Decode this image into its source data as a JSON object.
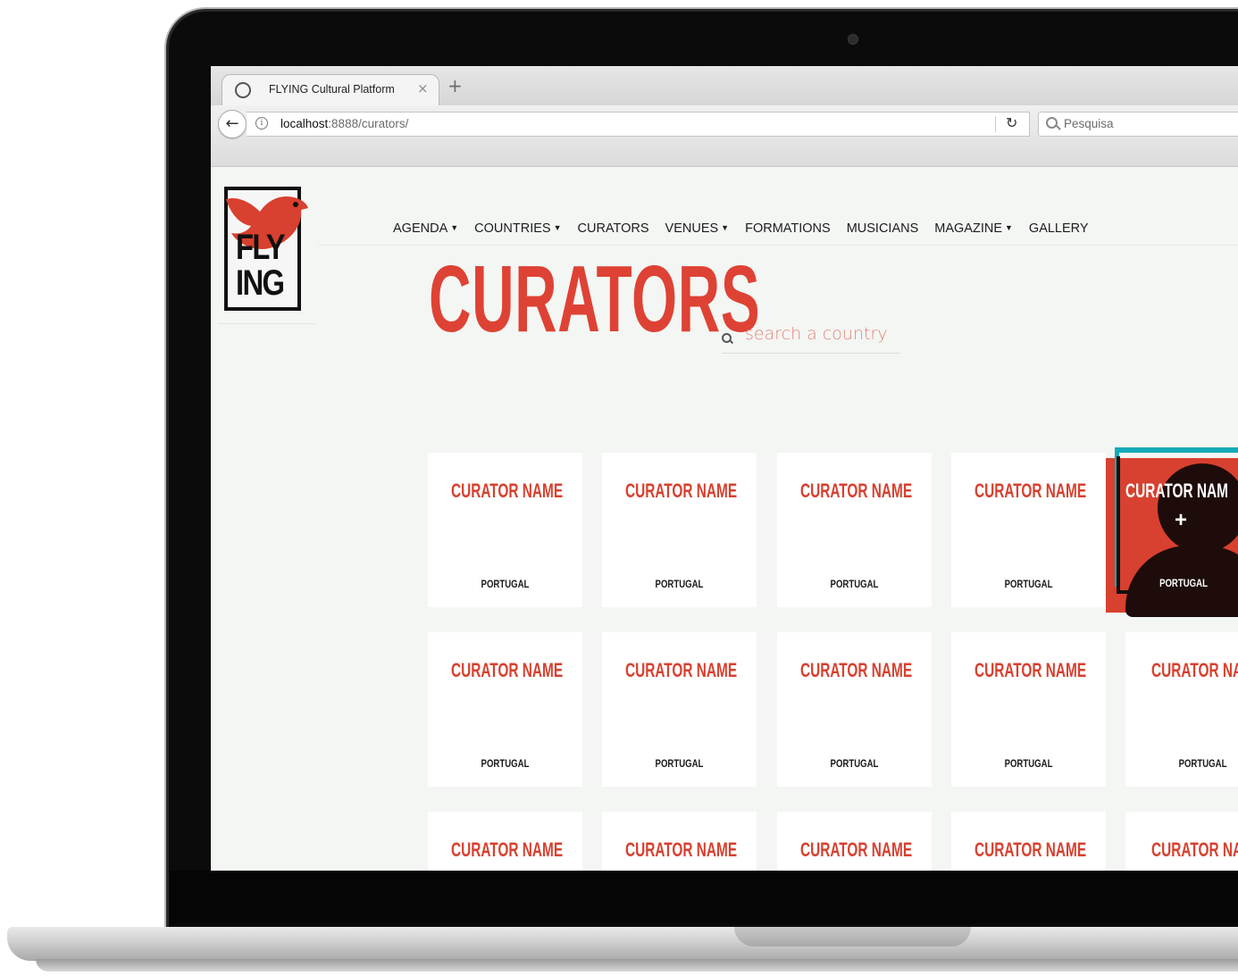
{
  "browser": {
    "tab_title": "FLYING Cultural Platform",
    "tab_close": "×",
    "new_tab": "+",
    "url_host": "localhost",
    "url_path": ":8888/curators/",
    "search_placeholder": "Pesquisa"
  },
  "site": {
    "logo_line1": "FLY",
    "logo_line2": "ING",
    "nav": [
      {
        "label": "AGENDA",
        "dropdown": true
      },
      {
        "label": "COUNTRIES",
        "dropdown": true
      },
      {
        "label": "CURATORS",
        "dropdown": false
      },
      {
        "label": "VENUES",
        "dropdown": true
      },
      {
        "label": "FORMATIONS",
        "dropdown": false
      },
      {
        "label": "MUSICIANS",
        "dropdown": false
      },
      {
        "label": "MAGAZINE",
        "dropdown": true
      },
      {
        "label": "GALLERY",
        "dropdown": false
      }
    ],
    "page_title": "CURATORS",
    "country_search_placeholder": "search a country"
  },
  "cards": [
    {
      "name": "CURATOR NAME",
      "country": "PORTUGAL"
    },
    {
      "name": "CURATOR NAME",
      "country": "PORTUGAL"
    },
    {
      "name": "CURATOR NAME",
      "country": "PORTUGAL"
    },
    {
      "name": "CURATOR NAME",
      "country": "PORTUGAL"
    },
    {
      "name": "CURATOR NAM",
      "country": "PORTUGAL",
      "hover": true,
      "hover_icon": "+"
    },
    {
      "name": "CURATOR NAME",
      "country": "PORTUGAL"
    },
    {
      "name": "CURATOR NAME",
      "country": "PORTUGAL"
    },
    {
      "name": "CURATOR NAME",
      "country": "PORTUGAL"
    },
    {
      "name": "CURATOR NAME",
      "country": "PORTUGAL"
    },
    {
      "name": "CURATOR NAM",
      "country": "PORTUGAL"
    },
    {
      "name": "CURATOR NAME",
      "country": ""
    },
    {
      "name": "CURATOR NAME",
      "country": ""
    },
    {
      "name": "CURATOR NAME",
      "country": ""
    },
    {
      "name": "CURATOR NAME",
      "country": ""
    },
    {
      "name": "CURATOR NAM",
      "country": ""
    }
  ],
  "colors": {
    "brand_red": "#d8402f",
    "hover_frame": "#17aab7",
    "page_bg": "#f3f6f3"
  },
  "icons": {
    "back": "arrow-left-icon",
    "info": "info-icon",
    "reload": "reload-icon",
    "search": "search-icon",
    "country_search": "search-icon",
    "dropdown": "caret-down-icon"
  }
}
